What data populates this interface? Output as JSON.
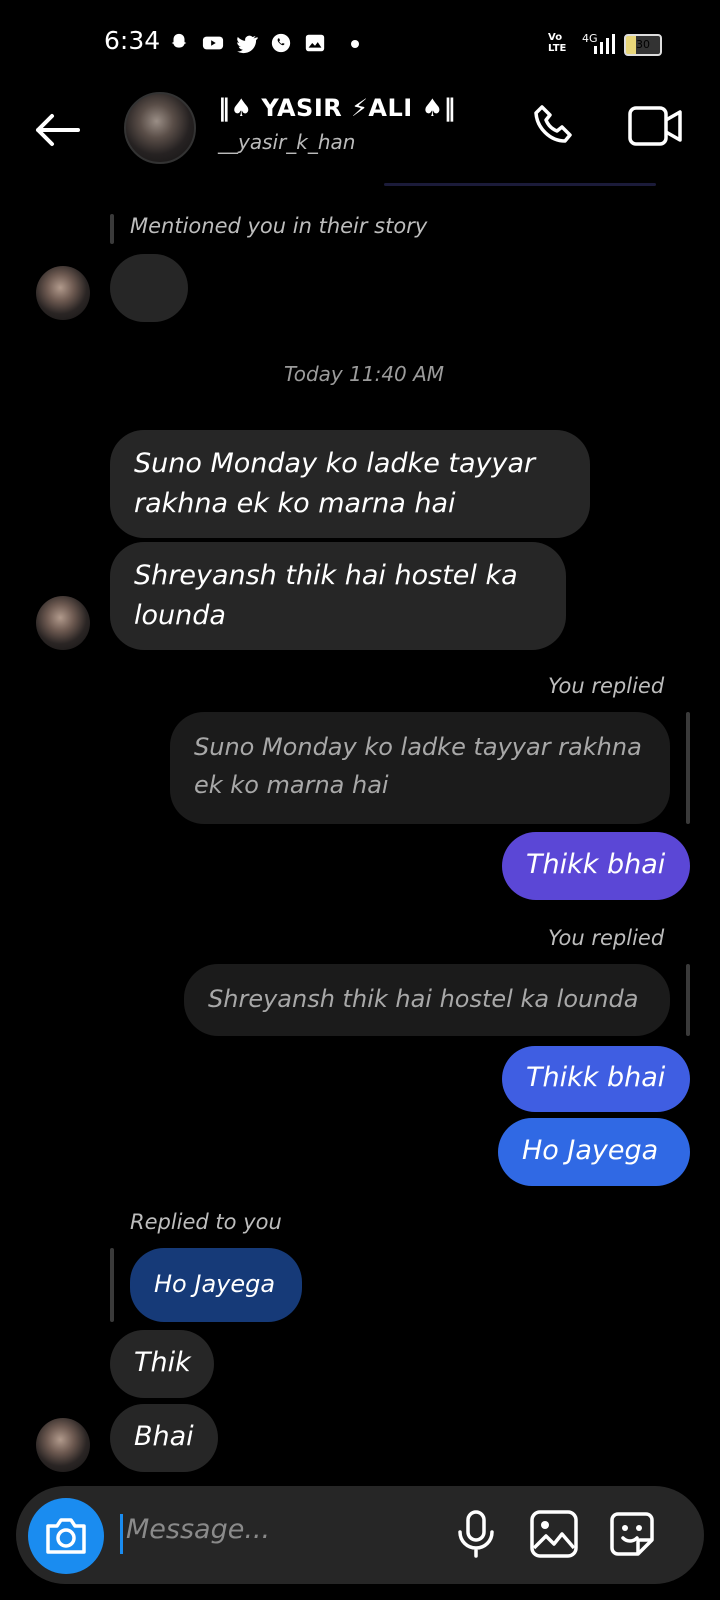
{
  "status_bar": {
    "time": "6:34",
    "network": "4G",
    "volte": "Vo LTE",
    "battery": "30",
    "icons": [
      "snapchat-icon",
      "youtube-icon",
      "twitter-icon",
      "whatsapp-icon",
      "gallery-icon",
      "dot-icon"
    ]
  },
  "header": {
    "title": "‖♠ YASIR ⚡ALI ♠‖",
    "username": "__yasir_k_han"
  },
  "messages": {
    "story_mention": "Mentioned you in their story",
    "timestamp": "Today 11:40 AM",
    "incoming_1": "Suno Monday ko ladke tayyar rakhna ek ko marna hai",
    "incoming_2": "Shreyansh thik hai hostel ka lounda",
    "you_replied_1": "You replied",
    "quoted_1": "Suno Monday ko ladke tayyar rakhna ek ko marna hai",
    "outgoing_1": "Thikk bhai",
    "you_replied_2": "You replied",
    "quoted_2": "Shreyansh thik hai hostel ka lounda",
    "outgoing_2": "Thikk bhai",
    "outgoing_3": "Ho Jayega",
    "replied_to_you": "Replied to you",
    "reply_quote": "Ho Jayega",
    "incoming_3": "Thik",
    "incoming_4": "Bhai"
  },
  "composer": {
    "placeholder": "Message..."
  },
  "colors": {
    "accent": "#1a8cf0",
    "outgoing_purple": "#5b47d6",
    "outgoing_blue": "#3f5ee2",
    "incoming_bg": "#262626"
  }
}
